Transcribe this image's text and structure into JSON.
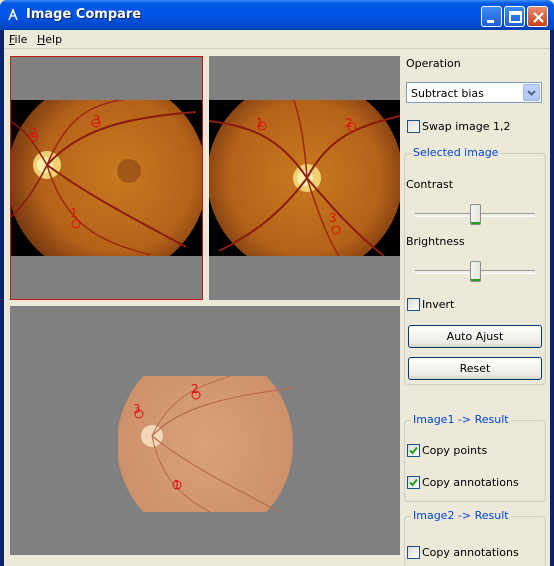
{
  "window": {
    "title": "Image Compare"
  },
  "menu": [
    {
      "label": "File",
      "mnemonic": "F",
      "rest": "ile"
    },
    {
      "label": "Help",
      "mnemonic": "H",
      "rest": "elp"
    }
  ],
  "images": {
    "image1": {
      "points": [
        "2",
        "3",
        "1"
      ],
      "selected": true
    },
    "image2": {
      "points": [
        "1",
        "2",
        "3"
      ]
    },
    "result": {
      "points": [
        "2",
        "3",
        "1"
      ]
    }
  },
  "controls": {
    "operation_label": "Operation",
    "operation_value": "Subtract bias",
    "swap": {
      "label": "Swap image 1,2",
      "checked": false
    },
    "selected_image_group": "Selected image",
    "contrast_label": "Contrast",
    "contrast_level": 0.5,
    "brightness_label": "Brightness",
    "brightness_level": 0.5,
    "invert": {
      "label": "Invert",
      "checked": false
    },
    "auto_adjust_label": "Auto Ajust",
    "reset_label": "Reset",
    "image1_result_group": "Image1 -> Result",
    "copy_points_1": {
      "label": "Copy points",
      "checked": true
    },
    "copy_annotations_1": {
      "label": "Copy annotations",
      "checked": true
    },
    "image2_result_group": "Image2 -> Result",
    "copy_annotations_2": {
      "label": "Copy annotations",
      "checked": false
    }
  },
  "colors": {
    "titlebar": "#0055e5",
    "selection_border": "#c11b17",
    "annotation": "#e01010",
    "group_title": "#0046d5"
  }
}
